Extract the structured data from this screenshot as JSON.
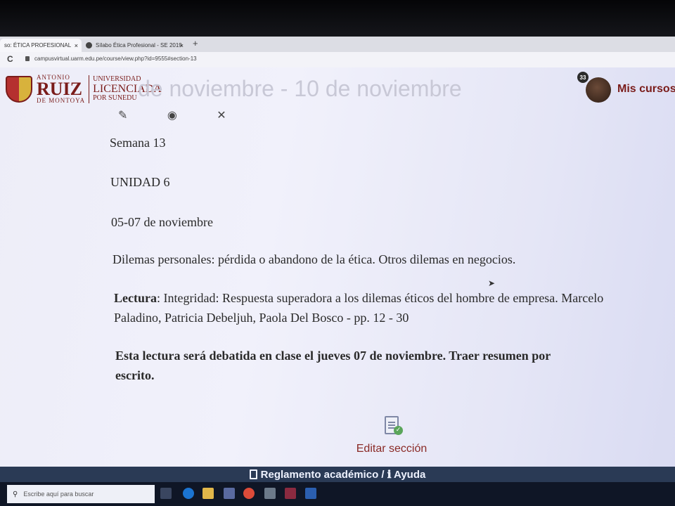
{
  "browser": {
    "tabs": [
      {
        "label": "so: ÉTICA PROFESIONAL",
        "close": "×"
      },
      {
        "label": "Sílabo Ética Profesional - SE 2019",
        "close": "×"
      }
    ],
    "new_tab": "+",
    "reload": "C",
    "url": "campusvirtual.uarm.edu.pe/course/view.php?id=9555#section-13"
  },
  "header": {
    "logo": {
      "line1": "ANTONIO",
      "line2": "RUIZ",
      "line3": "DE MONTOYA",
      "right1": "UNIVERSIDAD",
      "right2": "LICENCIADA",
      "right3": "POR SUNEDU"
    },
    "section_title": "de noviembre - 10 de noviembre",
    "notification_count": "33",
    "my_courses": "Mis cursos"
  },
  "content": {
    "edit_icons": "✎ ◉ ✕",
    "week": "Semana 13",
    "unit": "UNIDAD 6",
    "dates": "05-07 de noviembre",
    "topic": "Dilemas personales: pérdida o abandono de la ética. Otros dilemas en negocios.",
    "reading_label": "Lectura",
    "reading_line1": ": Integridad: Respuesta superadora a los dilemas éticos del hombre de empresa. Marcelo",
    "reading_line2": "Paladino, Patricia Debeljuh, Paola Del Bosco - pp. 12 - 30",
    "note_line1": "Esta lectura será debatida en clase el jueves 07 de noviembre. Traer resumen por",
    "note_line2": "escrito."
  },
  "edit_section": {
    "label": "Editar sección",
    "check": "✓"
  },
  "footer": {
    "label": "Reglamento académico / ℹ Ayuda"
  },
  "taskbar": {
    "search_placeholder": "Escribe aquí para buscar",
    "search_icon": "⚲"
  },
  "colors": {
    "accent": "#7a1c1a",
    "link": "#8a2a26",
    "footer_bg": "#2a3a55"
  }
}
